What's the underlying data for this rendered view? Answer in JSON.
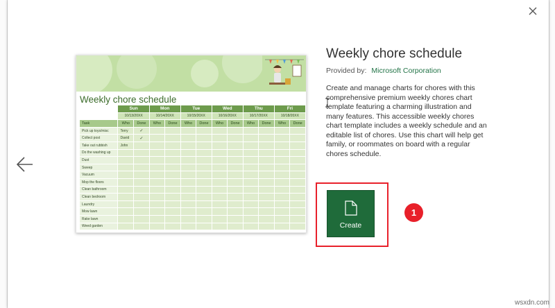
{
  "template": {
    "title": "Weekly chore schedule",
    "provided_by_label": "Provided by:",
    "provider": "Microsoft Corporation",
    "description": "Create and manage charts for chores with this comprehensive premium weekly chores chart template featuring a charming illustration and many features. This accessible weekly chores chart template includes a weekly schedule and an editable list of chores. Use this chart will help get family, or roommates on board with a regular chores schedule.",
    "create_label": "Create"
  },
  "preview": {
    "sheet_title": "Weekly chore schedule",
    "days": [
      "Sun",
      "Mon",
      "Tue",
      "Wed",
      "Thu",
      "Fri"
    ],
    "dates": [
      "10/13/20XX",
      "10/14/20XX",
      "10/15/20XX",
      "10/16/20XX",
      "10/17/20XX",
      "10/18/20XX"
    ],
    "task_header": "Task",
    "who_label": "Who",
    "done_label": "Done",
    "rows": [
      {
        "task": "Pick up toys/misc",
        "who": "Terry",
        "done": "✓"
      },
      {
        "task": "Collect post",
        "who": "David",
        "done": "✓"
      },
      {
        "task": "Take out rubbish",
        "who": "John",
        "done": ""
      },
      {
        "task": "Do the washing up",
        "who": "",
        "done": ""
      },
      {
        "task": "Dust",
        "who": "",
        "done": ""
      },
      {
        "task": "Sweep",
        "who": "",
        "done": ""
      },
      {
        "task": "Vacuum",
        "who": "",
        "done": ""
      },
      {
        "task": "Mop the floors",
        "who": "",
        "done": ""
      },
      {
        "task": "Clean bathroom",
        "who": "",
        "done": ""
      },
      {
        "task": "Clean bedroom",
        "who": "",
        "done": ""
      },
      {
        "task": "Laundry",
        "who": "",
        "done": ""
      },
      {
        "task": "Mow lawn",
        "who": "",
        "done": ""
      },
      {
        "task": "Rake lawn",
        "who": "",
        "done": ""
      },
      {
        "task": "Weed garden",
        "who": "",
        "done": ""
      }
    ]
  },
  "annotation": {
    "step_number": "1",
    "highlight_color": "#e8202a"
  },
  "watermark": "wsxdn.com",
  "colors": {
    "create_button": "#1f6b3a",
    "provider_link": "#217346",
    "sheet_accent": "#6d9b4c"
  }
}
